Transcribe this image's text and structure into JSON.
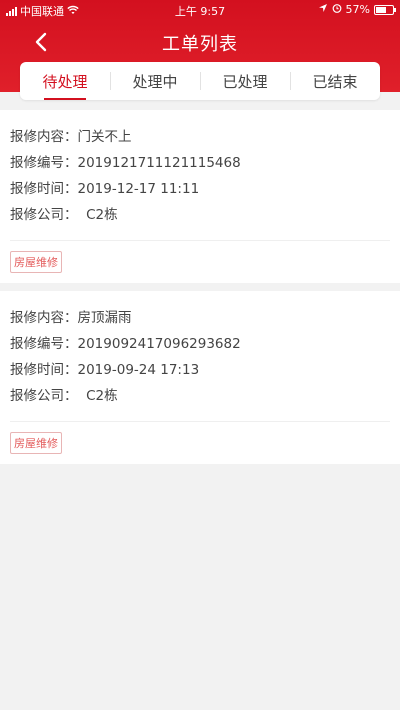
{
  "status_bar": {
    "carrier": "中国联通",
    "time": "上午 9:57",
    "battery": "57%"
  },
  "header": {
    "title": "工单列表",
    "back_icon": "chevron-left-icon"
  },
  "tabs": [
    {
      "label": "待处理",
      "active": true
    },
    {
      "label": "处理中",
      "active": false
    },
    {
      "label": "已处理",
      "active": false
    },
    {
      "label": "已结束",
      "active": false
    }
  ],
  "labels": {
    "content": "报修内容：",
    "number": "报修编号：",
    "time": "报修时间：",
    "company": "报修公司："
  },
  "orders": [
    {
      "content": "门关不上",
      "number": "2019121711121115468",
      "time": "2019-12-17 11:11",
      "company": "C2栋",
      "tag": "房屋维修"
    },
    {
      "content": "房顶漏雨",
      "number": "2019092417096293682",
      "time": "2019-09-24 17:13",
      "company": "C2栋",
      "tag": "房屋维修"
    }
  ],
  "colors": {
    "brand": "#d3101f",
    "tag_text": "#e35a5a"
  }
}
